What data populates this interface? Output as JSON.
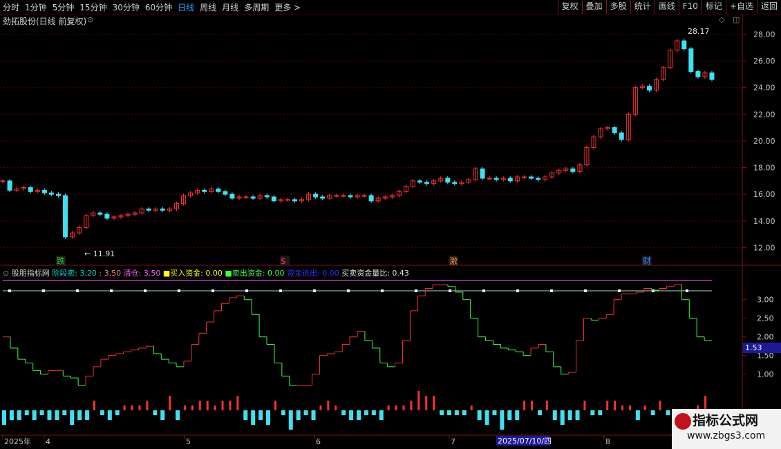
{
  "toolbar": {
    "periods": [
      "分时",
      "1分钟",
      "5分钟",
      "15分钟",
      "30分钟",
      "60分钟",
      "日线",
      "周线",
      "月线",
      "多周期",
      "更多 >"
    ],
    "active_period": "日线",
    "right_buttons": [
      "复权",
      "叠加",
      "多股",
      "统计",
      "画线",
      "F10",
      "标记",
      "+自选",
      "返回"
    ]
  },
  "main_chart": {
    "title": "劲拓股份(日线 前复权)",
    "y_ticks": [
      "28.00",
      "26.00",
      "24.00",
      "22.00",
      "20.00",
      "18.00",
      "16.00",
      "14.00",
      "12.00"
    ],
    "high_label": "28.17",
    "low_label": "11.91",
    "event_marks": [
      "跌",
      "$",
      "激",
      "财"
    ]
  },
  "indicator": {
    "name": "股朋指标网",
    "legend": [
      {
        "label": "阶段卖: 3.20",
        "color": "#00d0d0"
      },
      {
        "label": ": 3.50",
        "color": "#ff8080"
      },
      {
        "label": "清仓: 3.50",
        "color": "#ff60ff"
      },
      {
        "label": "■买入资金: 0.00",
        "color": "#ffff00"
      },
      {
        "label": "■卖出资金: 0.00",
        "color": "#40ff40"
      },
      {
        "label": "资金进出: 0.00",
        "color": "#3030ff"
      },
      {
        "label": "买卖资金量比: 0.43",
        "color": "#e0e0e0"
      }
    ],
    "y_ticks": [
      "3.00",
      "2.50",
      "2.00",
      "1.50",
      "1.00"
    ],
    "current_value": "1.53"
  },
  "x_axis": {
    "labels": [
      "2025年",
      "4",
      "5",
      "6",
      "7",
      "8"
    ],
    "cursor_date": "2025/07/10/四"
  },
  "watermark": {
    "title": "指标公式网",
    "url": "www.zbgs3.com"
  },
  "colors": {
    "up": "#ff3030",
    "down": "#40e0f0",
    "green_step": "#40ff40",
    "red_step": "#ff3030",
    "grid": "#5a0000"
  },
  "chart_data": {
    "type": "candlestick",
    "closes": [
      17.0,
      16.3,
      16.4,
      16.5,
      16.2,
      16.3,
      16.1,
      16.0,
      15.9,
      12.8,
      13.1,
      13.5,
      14.4,
      14.6,
      14.5,
      14.2,
      14.3,
      14.4,
      14.5,
      14.6,
      14.9,
      14.8,
      14.9,
      14.8,
      14.9,
      15.3,
      15.9,
      16.1,
      16.3,
      16.2,
      16.4,
      16.2,
      16.0,
      15.7,
      15.8,
      15.8,
      15.7,
      15.9,
      15.8,
      15.5,
      15.6,
      15.6,
      15.5,
      15.6,
      16.0,
      15.8,
      15.7,
      15.9,
      15.9,
      15.9,
      15.8,
      15.9,
      15.9,
      15.5,
      15.7,
      15.8,
      15.9,
      16.2,
      16.6,
      17.0,
      16.9,
      16.8,
      17.0,
      17.2,
      16.9,
      16.8,
      16.9,
      17.1,
      17.9,
      17.2,
      17.2,
      17.1,
      17.2,
      17.0,
      17.3,
      17.3,
      17.2,
      17.1,
      17.3,
      17.6,
      17.8,
      17.9,
      17.7,
      18.2,
      19.5,
      20.3,
      20.9,
      21.0,
      20.6,
      20.1,
      22.0,
      24.0,
      24.1,
      23.8,
      24.6,
      25.5,
      26.8,
      27.5,
      26.9,
      25.2,
      24.8,
      25.1,
      24.6
    ],
    "ylim": [
      11.4,
      28.8
    ],
    "indicator_steps": [
      2.0,
      1.7,
      1.4,
      1.3,
      1.1,
      1.0,
      1.1,
      1.1,
      0.95,
      0.9,
      0.7,
      0.95,
      1.2,
      1.4,
      1.5,
      1.55,
      1.6,
      1.65,
      1.7,
      1.75,
      1.55,
      1.4,
      1.3,
      1.2,
      1.35,
      1.8,
      2.1,
      2.4,
      2.7,
      2.9,
      3.05,
      3.1,
      3.0,
      2.6,
      2.0,
      1.8,
      1.3,
      0.95,
      0.7,
      0.7,
      0.7,
      1.0,
      1.5,
      1.55,
      1.6,
      1.8,
      2.0,
      2.15,
      1.9,
      1.7,
      1.3,
      1.2,
      1.3,
      1.9,
      2.7,
      3.1,
      3.3,
      3.4,
      3.4,
      3.35,
      3.2,
      3.0,
      2.5,
      2.0,
      1.9,
      1.8,
      1.7,
      1.65,
      1.6,
      1.5,
      1.7,
      1.8,
      1.6,
      1.2,
      1.0,
      1.05,
      1.9,
      2.5,
      2.45,
      2.5,
      2.6,
      3.0,
      3.15,
      3.15,
      3.2,
      3.3,
      3.25,
      3.3,
      3.35,
      3.4,
      3.0,
      2.5,
      2.0,
      1.9
    ],
    "indicator_ylim": [
      0.55,
      3.55
    ],
    "volume_bars": [
      -3,
      -2,
      -2,
      -1,
      -2,
      -1,
      -2,
      -2,
      -1,
      -3,
      -2,
      -2,
      2,
      -1,
      -2,
      -1,
      1,
      1,
      1,
      2,
      -1,
      -2,
      3,
      -2,
      1,
      1,
      2,
      2,
      1,
      2,
      2,
      3,
      -2,
      -3,
      -2,
      -3,
      2,
      -1,
      -4,
      -2,
      -1,
      -2,
      1,
      2,
      1,
      -1,
      -2,
      -2,
      -1,
      -1,
      -2,
      1,
      1,
      1,
      2,
      4,
      3,
      3,
      -1,
      -1,
      -1,
      -1,
      1,
      -2,
      -3,
      -1,
      -4,
      -2,
      -2,
      2,
      2,
      -1,
      2,
      -2,
      -3,
      -2,
      -2,
      2,
      -1,
      -1,
      2,
      2,
      1,
      1,
      -2,
      1,
      -1,
      2,
      -1,
      -1,
      -2,
      -2,
      1,
      3
    ]
  }
}
